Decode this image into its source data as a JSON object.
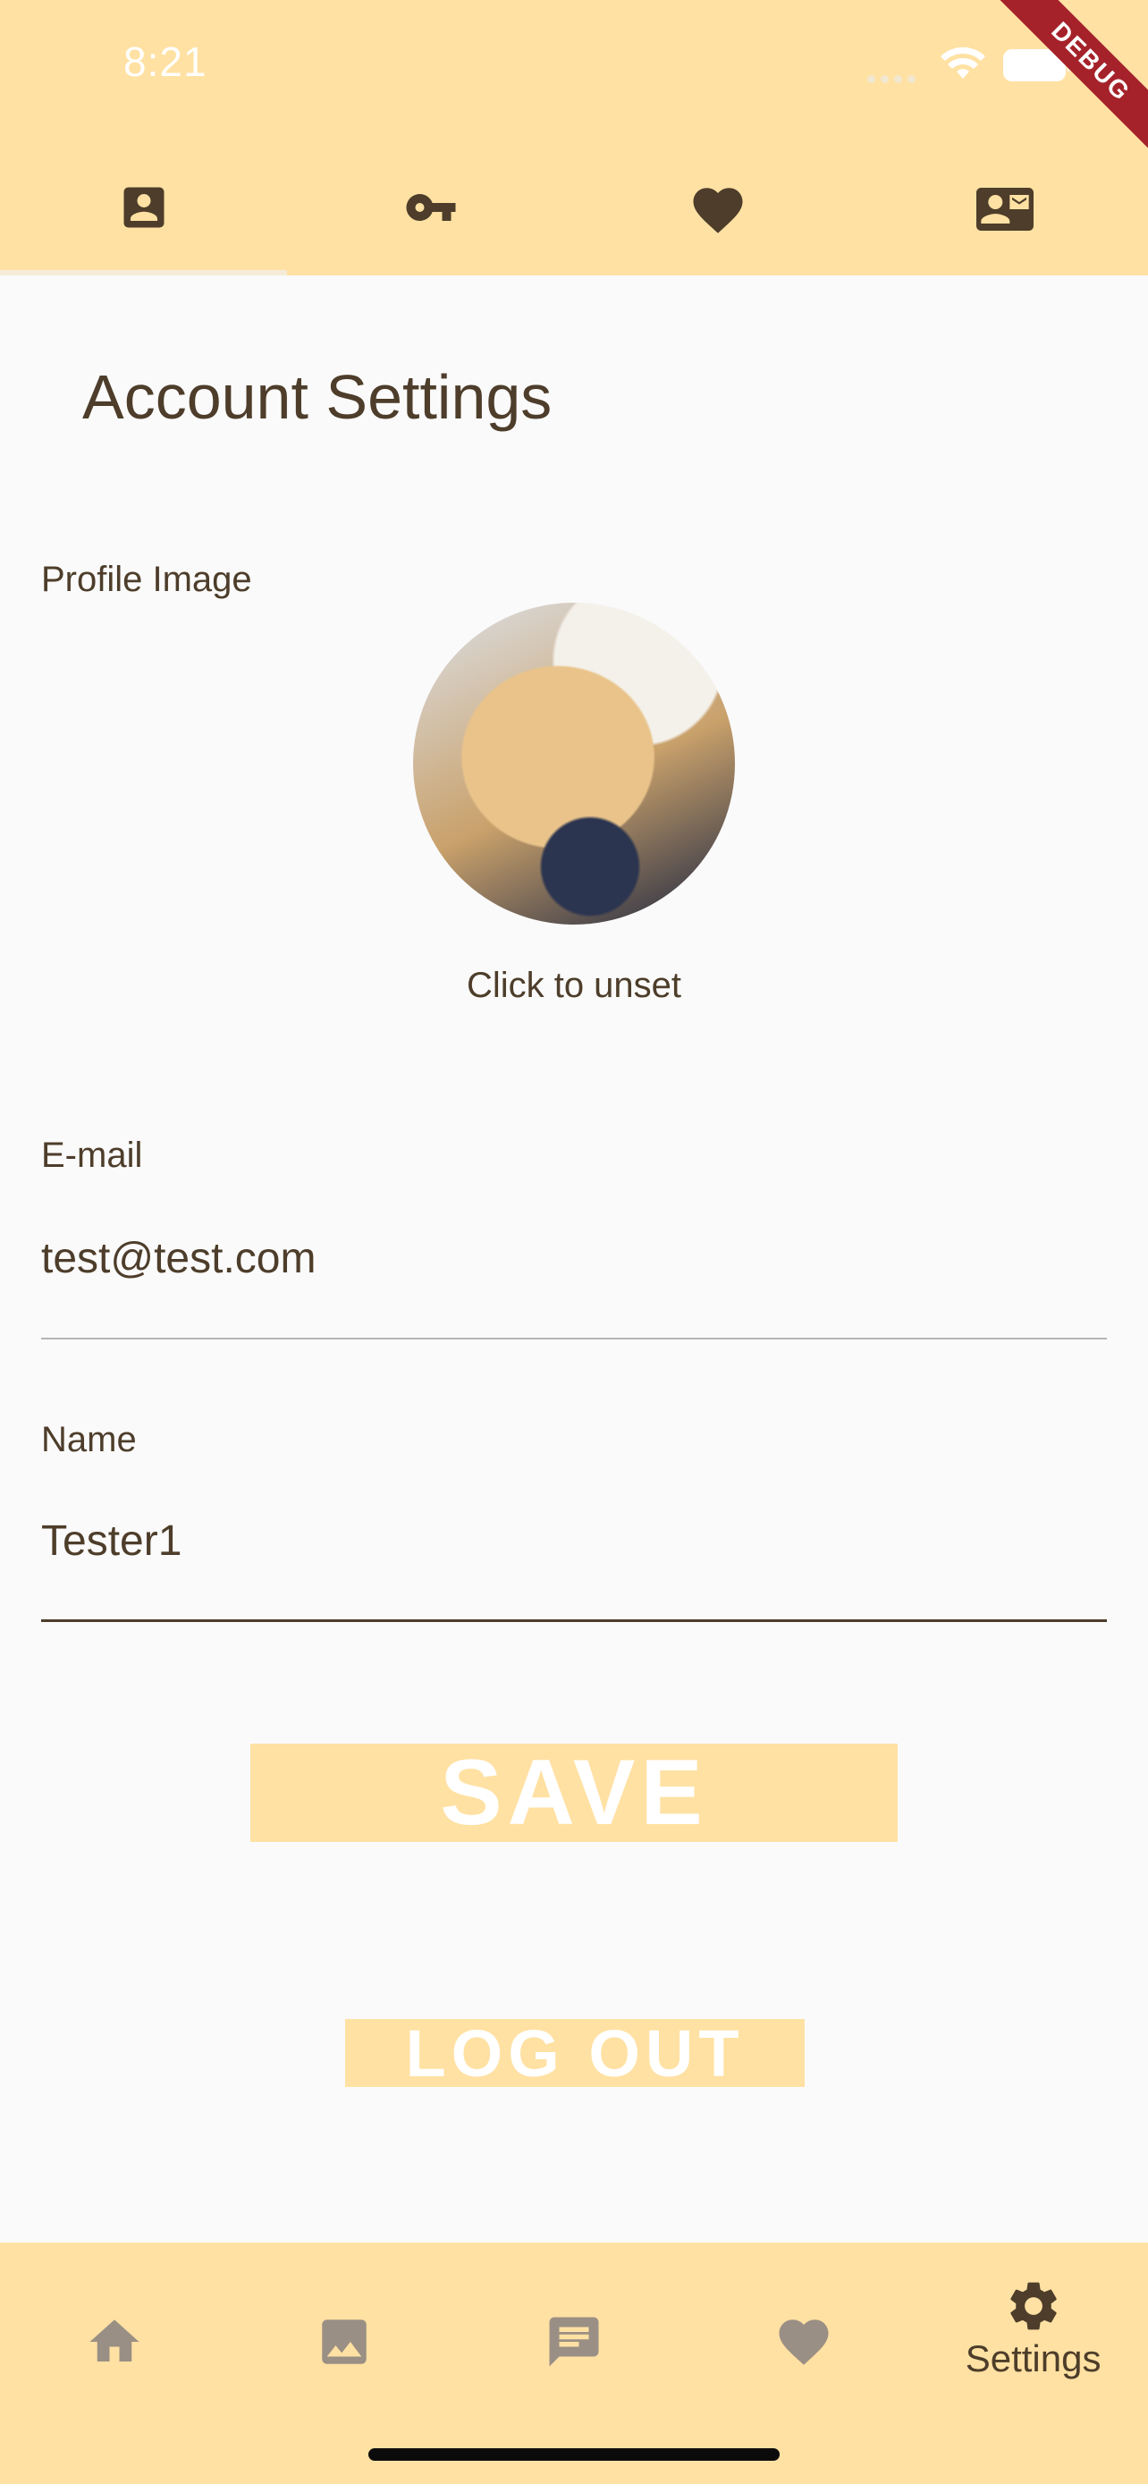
{
  "status_bar": {
    "time": "8:21",
    "debug": "DEBUG"
  },
  "top_tabs": [
    {
      "icon": "account-box-icon"
    },
    {
      "icon": "key-icon"
    },
    {
      "icon": "heart-icon"
    },
    {
      "icon": "contact-mail-icon"
    }
  ],
  "page": {
    "title": "Account Settings",
    "profile_label": "Profile Image",
    "unset_text": "Click to unset",
    "email_label": "E-mail",
    "email_value": "test@test.com",
    "name_label": "Name",
    "name_value": "Tester1",
    "save_label": "SAVE",
    "logout_label": "LOG OUT"
  },
  "bottom_nav": {
    "items": [
      {
        "icon": "home-icon"
      },
      {
        "icon": "image-icon"
      },
      {
        "icon": "chat-icon"
      },
      {
        "icon": "heart-icon"
      },
      {
        "icon": "settings-icon",
        "label": "Settings"
      }
    ]
  },
  "colors": {
    "accent": "#ffe1a3",
    "text": "#4d3d2a",
    "inactive_icon": "#9a8f84",
    "background": "#fafafa"
  }
}
